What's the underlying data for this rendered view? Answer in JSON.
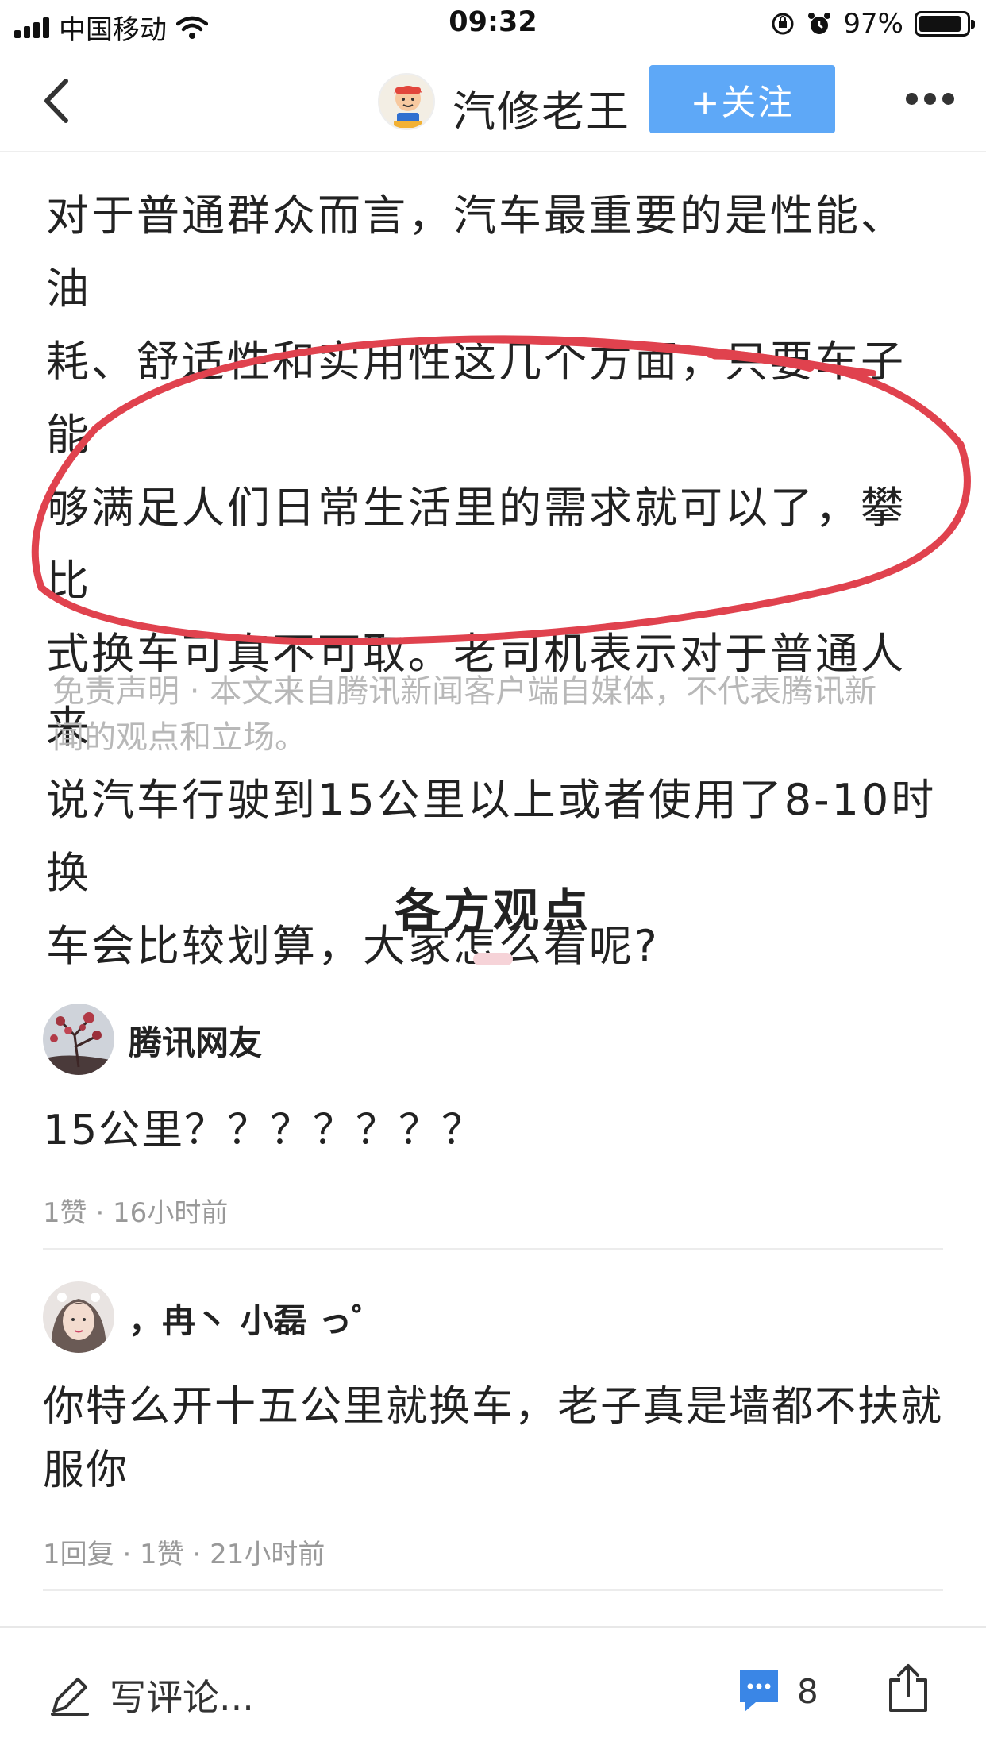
{
  "status": {
    "carrier": "中国移动",
    "time": "09:32",
    "battery": "97%"
  },
  "header": {
    "author_name": "汽修老王",
    "follow_label": "+关注"
  },
  "article": {
    "line1": "对于普通群众而言，汽车最重要的是性能、油",
    "line2": "耗、舒适性和实用性这几个方面，只要车子能",
    "line3": "够满足人们日常生活里的需求就可以了，攀比",
    "line4": "式换车可真不可取。老司机表示对于普通人来",
    "line5": "说汽车行驶到15公里以上或者使用了8-10时换",
    "line6": "车会比较划算，大家怎么看呢?",
    "disclaimer_1": "免责声明 · 本文来自腾讯新闻客户端自媒体，不代表腾讯新",
    "disclaimer_2": "闻的观点和立场。"
  },
  "section": {
    "title": "各方观点"
  },
  "comments": [
    {
      "name": "腾讯网友",
      "text": "15公里？？？？？？？",
      "meta": "1赞 · 16小时前"
    },
    {
      "name": "，冉丶 小磊 っ゜",
      "text_line1": "你特么开十五公里就换车，老子真是墙都不扶就",
      "text_line2": "服你",
      "meta": "1回复 · 1赞 · 21小时前"
    }
  ],
  "bottom_bar": {
    "write_placeholder": "写评论...",
    "comment_count": "8"
  },
  "colors": {
    "follow_button": "#5ea8f7",
    "annotation_circle": "#e0424e",
    "comment_icon": "#3a86e6"
  }
}
